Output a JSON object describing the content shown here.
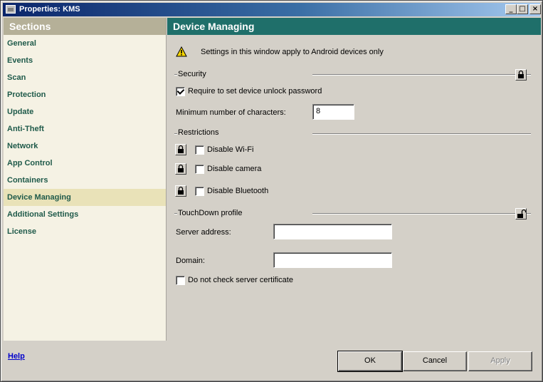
{
  "window": {
    "title": "Properties: KMS"
  },
  "sidebar": {
    "header": "Sections",
    "items": [
      {
        "label": "General"
      },
      {
        "label": "Events"
      },
      {
        "label": "Scan"
      },
      {
        "label": "Protection"
      },
      {
        "label": "Update"
      },
      {
        "label": "Anti-Theft"
      },
      {
        "label": "Network"
      },
      {
        "label": "App Control"
      },
      {
        "label": "Containers"
      },
      {
        "label": "Device Managing",
        "active": true
      },
      {
        "label": "Additional Settings"
      },
      {
        "label": "License"
      }
    ]
  },
  "main": {
    "title": "Device Managing",
    "notice": "Settings in this window apply to Android devices only",
    "security": {
      "label": "Security",
      "require_password": {
        "label": "Require to set device unlock password",
        "checked": true
      },
      "min_chars": {
        "label": "Minimum number of characters:",
        "value": "8"
      }
    },
    "restrictions": {
      "label": "Restrictions",
      "disable_wifi": {
        "label": "Disable Wi-Fi",
        "checked": false
      },
      "disable_camera": {
        "label": "Disable camera",
        "checked": false
      },
      "disable_bluetooth": {
        "label": "Disable Bluetooth",
        "checked": false
      }
    },
    "touchdown": {
      "label": "TouchDown profile",
      "server_address": {
        "label": "Server address:",
        "value": ""
      },
      "domain": {
        "label": "Domain:",
        "value": ""
      },
      "no_cert_check": {
        "label": "Do not check server certificate",
        "checked": false
      }
    }
  },
  "footer": {
    "help": "Help",
    "ok": "OK",
    "cancel": "Cancel",
    "apply": "Apply"
  },
  "colors": {
    "sidebar_header": "#b5b098",
    "main_header": "#1f6f6a",
    "sidebar_text": "#1f5a4a",
    "active_item": "#e9e2b8"
  }
}
